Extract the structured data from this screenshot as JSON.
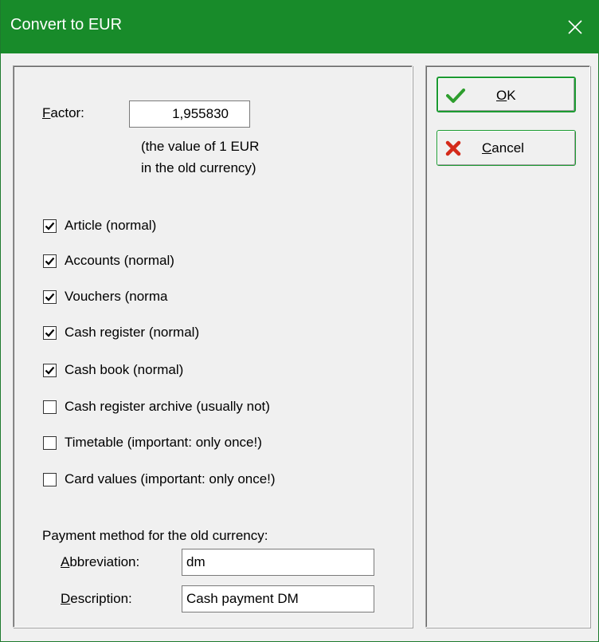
{
  "window": {
    "title": "Convert to EUR"
  },
  "factor": {
    "label": "Factor:",
    "value": "1,955830",
    "hint_line1": "(the value of 1 EUR",
    "hint_line2": "in the old currency)"
  },
  "checkboxes": [
    {
      "label": "Article (normal)",
      "checked": true
    },
    {
      "label": "Accounts (normal)",
      "checked": true
    },
    {
      "label": "Vouchers (norma",
      "checked": true
    },
    {
      "label": "Cash register (normal)",
      "checked": true
    },
    {
      "label": "Cash book (normal)",
      "checked": true
    },
    {
      "label": "Cash register archive (usually not)",
      "checked": false
    },
    {
      "label": "Timetable (important: only once!)",
      "checked": false
    },
    {
      "label": "Card values (important: only once!)",
      "checked": false
    }
  ],
  "payment": {
    "heading": "Payment method for the old currency:",
    "abbreviation_label": "Abbreviation:",
    "abbreviation_value": "dm",
    "description_label": "Description:",
    "description_value": "Cash payment DM"
  },
  "buttons": {
    "ok_label": "OK",
    "cancel_label": "Cancel"
  },
  "colors": {
    "titlebar": "#188b2a",
    "ok_check": "#2e9e2e",
    "cancel_x": "#d42a1a"
  }
}
